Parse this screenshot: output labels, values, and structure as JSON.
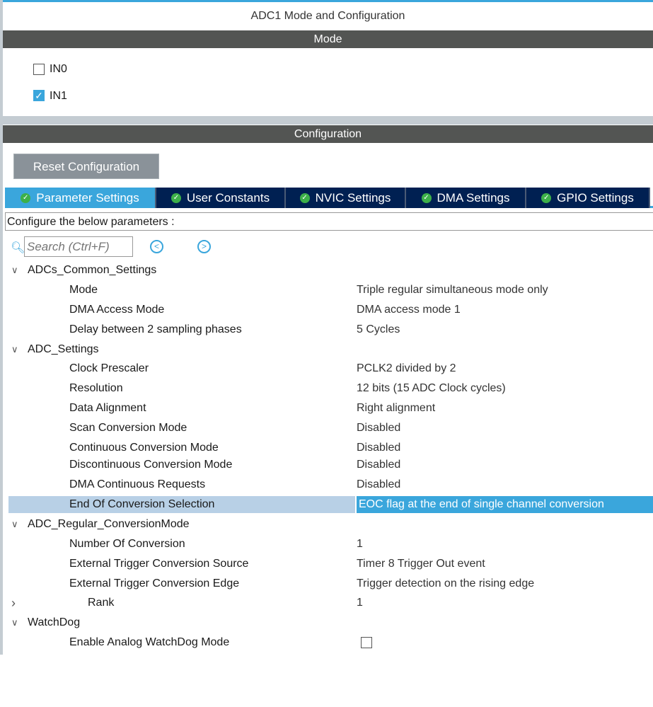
{
  "title": "ADC1 Mode and Configuration",
  "mode_header": "Mode",
  "mode_items": [
    {
      "label": "IN0",
      "checked": false
    },
    {
      "label": "IN1",
      "checked": true
    }
  ],
  "config_header": "Configuration",
  "reset_label": "Reset Configuration",
  "tabs": [
    "Parameter Settings",
    "User Constants",
    "NVIC Settings",
    "DMA Settings",
    "GPIO Settings"
  ],
  "configure_text": "Configure the below parameters :",
  "search_placeholder": "Search (Ctrl+F)",
  "rows": [
    {
      "k": "ADCs_Common_Settings",
      "v": "",
      "type": "group"
    },
    {
      "k": "Mode",
      "v": "Triple regular simultaneous mode only"
    },
    {
      "k": "DMA Access Mode",
      "v": "DMA access mode 1"
    },
    {
      "k": "Delay between 2 sampling phases",
      "v": "5 Cycles"
    },
    {
      "k": "ADC_Settings",
      "v": "",
      "type": "group"
    },
    {
      "k": "Clock Prescaler",
      "v": "PCLK2 divided by 2"
    },
    {
      "k": "Resolution",
      "v": "12 bits (15 ADC Clock cycles)"
    },
    {
      "k": "Data Alignment",
      "v": "Right alignment"
    },
    {
      "k": "Scan Conversion Mode",
      "v": "Disabled"
    },
    {
      "k": "Continuous Conversion Mode",
      "v": "Disabled"
    },
    {
      "k": "Discontinuous Conversion Mode",
      "v": "Disabled"
    },
    {
      "k": "DMA Continuous Requests",
      "v": "Disabled"
    },
    {
      "k": "End Of Conversion Selection",
      "v": "EOC flag at the end of single channel conversion",
      "selected": true
    },
    {
      "k": "ADC_Regular_ConversionMode",
      "v": "",
      "type": "group"
    },
    {
      "k": "Number Of Conversion",
      "v": "1"
    },
    {
      "k": "External Trigger Conversion Source",
      "v": "Timer 8 Trigger Out event"
    },
    {
      "k": "External Trigger Conversion Edge",
      "v": "Trigger detection on the rising edge"
    },
    {
      "k": "Rank",
      "v": "1",
      "type": "sub"
    },
    {
      "k": "WatchDog",
      "v": "",
      "type": "group"
    },
    {
      "k": "Enable Analog WatchDog Mode",
      "v": "",
      "type": "checkbox"
    }
  ]
}
